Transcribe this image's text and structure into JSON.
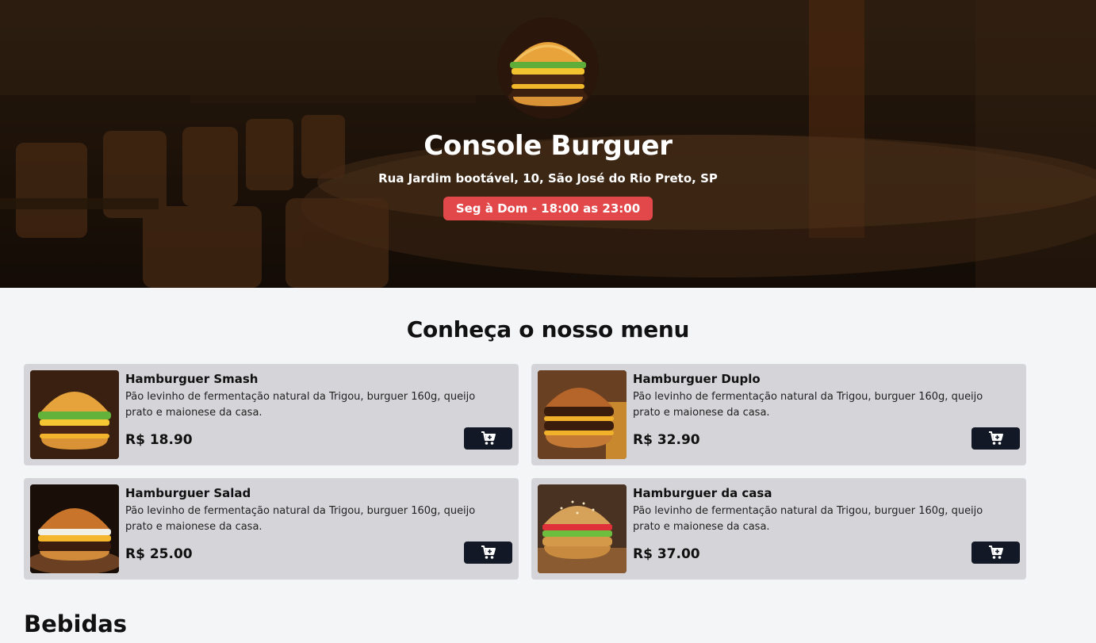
{
  "restaurant": {
    "name": "Console Burguer",
    "address": "Rua Jardim bootável, 10, São José do Rio Preto, SP",
    "hours": "Seg à Dom - 18:00 as 23:00"
  },
  "menu": {
    "title": "Conheça o nosso menu",
    "items": [
      {
        "name": "Hamburguer Smash",
        "description": "Pão levinho de fermentação natural da Trigou, burguer 160g, queijo prato e maionese da casa.",
        "price": "R$ 18.90",
        "image_icon": "smash-burger-photo"
      },
      {
        "name": "Hamburguer Duplo",
        "description": "Pão levinho de fermentação natural da Trigou, burguer 160g, queijo prato e maionese da casa.",
        "price": "R$ 32.90",
        "image_icon": "double-burger-photo"
      },
      {
        "name": "Hamburguer Salad",
        "description": "Pão levinho de fermentação natural da Trigou, burguer 160g, queijo prato e maionese da casa.",
        "price": "R$ 25.00",
        "image_icon": "salad-burger-photo"
      },
      {
        "name": "Hamburguer da casa",
        "description": "Pão levinho de fermentação natural da Trigou, burguer 160g, queijo prato e maionese da casa.",
        "price": "R$ 37.00",
        "image_icon": "house-burger-photo"
      }
    ],
    "cart_icon": "cart-plus-icon"
  },
  "sections": {
    "drinks_title": "Bebidas"
  },
  "colors": {
    "badge": "#e2474a",
    "card": "#d5d4d8",
    "button": "#121826",
    "page_bg": "#f4f5f7"
  }
}
